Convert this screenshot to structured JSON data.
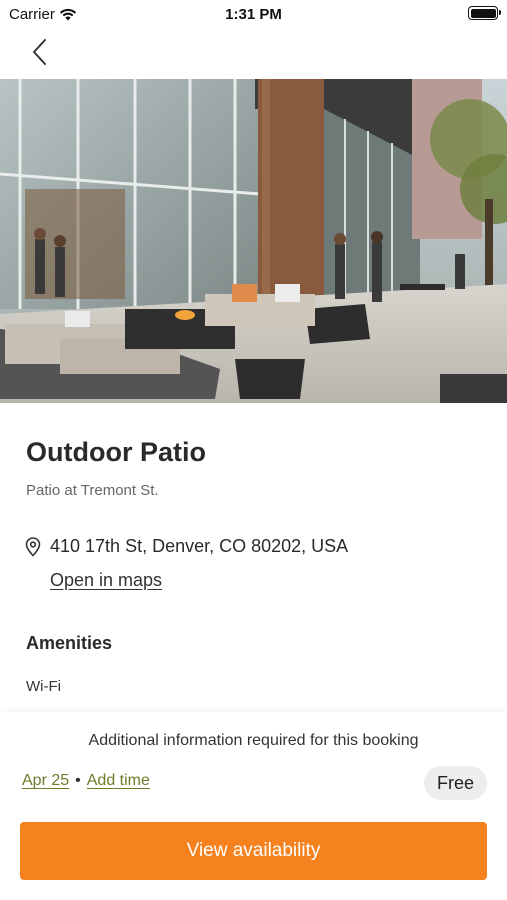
{
  "status_bar": {
    "carrier": "Carrier",
    "time": "1:31 PM",
    "battery_level": 1.0
  },
  "nav": {
    "back_icon": "chevron-left-icon"
  },
  "hero": {
    "alt": "Outdoor patio with lounge seating, fire table and glass building facade"
  },
  "space": {
    "title": "Outdoor Patio",
    "subtitle": "Patio at Tremont St."
  },
  "location": {
    "icon": "map-pin-icon",
    "address": "410 17th St, Denver, CO 80202, USA",
    "maps_link": "Open in maps"
  },
  "amenities": {
    "heading": "Amenities",
    "items": [
      "Wi-Fi"
    ]
  },
  "booking": {
    "info_note": "Additional information required for this booking",
    "date": "Apr 25",
    "separator": "•",
    "time_link": "Add time",
    "price": "Free",
    "cta_label": "View availability"
  },
  "colors": {
    "accent": "#f5821f",
    "link_olive": "#6f7a2a",
    "badge_bg": "#ededed"
  }
}
